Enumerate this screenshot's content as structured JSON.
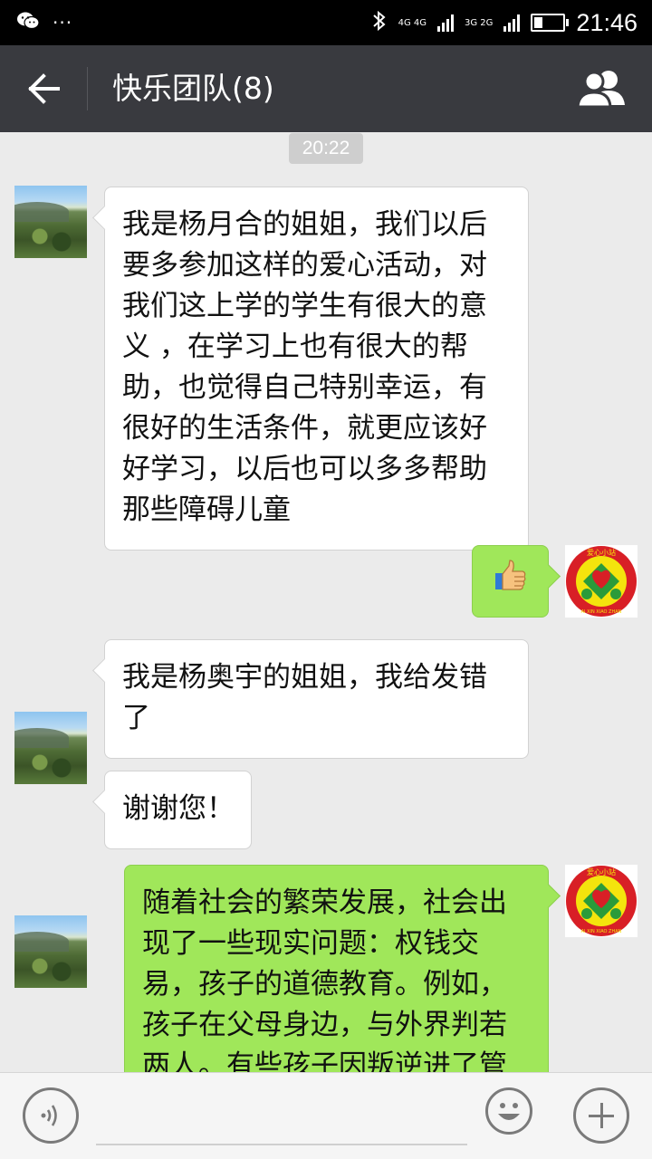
{
  "status_bar": {
    "time": "21:46",
    "network_1": "4G 4G",
    "network_2": "3G 2G",
    "overflow_dots": "···",
    "battery_level": 0.28
  },
  "header": {
    "title": "快乐团队(8)",
    "back_icon": "back-arrow-icon",
    "members_icon": "group-members-icon"
  },
  "chat": {
    "timestamp": "20:22",
    "messages": [
      {
        "side": "in",
        "avatar": "landscape-avatar",
        "text": "我是杨月合的姐姐，我们以后要多参加这样的爱心活动，对我们这上学的学生有很大的意义 ，在学习上也有很大的帮助，也觉得自己特别幸运，有很好的生活条件，就更应该好好学习，以后也可以多多帮助那些障碍儿童"
      },
      {
        "side": "out",
        "avatar": "aixin-xiaozhan-logo",
        "emoji": "thumbs-up-emoji"
      },
      {
        "side": "in",
        "avatar": "landscape-avatar",
        "text": "我是杨奥宇的姐姐，我给发错了"
      },
      {
        "side": "in",
        "avatar": "landscape-avatar",
        "text": "谢谢您！"
      },
      {
        "side": "out",
        "avatar": "aixin-xiaozhan-logo",
        "text": "随着社会的繁荣发展，社会出现了一些现实问题：权钱交易，孩子的道德教育。例如，孩子在父母身边，与外界判若两人。有些孩子因叛逆进了管"
      }
    ]
  },
  "input_bar": {
    "voice_icon": "voice-icon",
    "emoji_icon": "emoji-icon",
    "plus_icon": "plus-icon",
    "text_value": ""
  },
  "logo_text": {
    "top": "爱心小站",
    "bottom": "AI XIN XIAO ZHAN"
  },
  "colors": {
    "header_bg": "#393a3f",
    "chat_bg": "#ebebeb",
    "out_bubble": "#a0e75a",
    "in_bubble": "#ffffff"
  }
}
